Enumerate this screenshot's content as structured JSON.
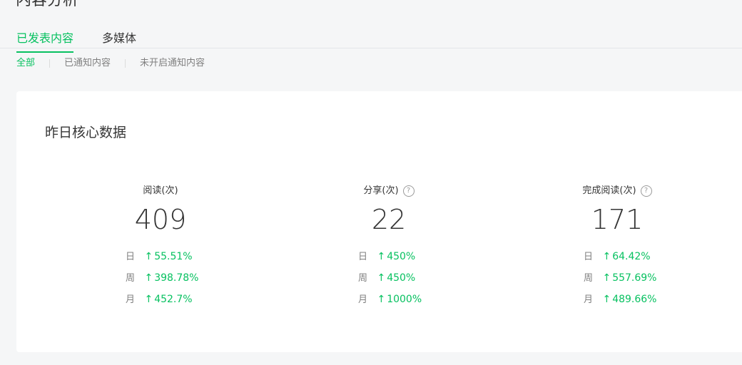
{
  "page": {
    "heading": "内容分析"
  },
  "tabs": [
    {
      "label": "已发表内容",
      "active": true
    },
    {
      "label": "多媒体",
      "active": false
    }
  ],
  "subtabs": [
    {
      "label": "全部",
      "active": true
    },
    {
      "label": "已通知内容",
      "active": false
    },
    {
      "label": "未开启通知内容",
      "active": false
    }
  ],
  "card": {
    "title": "昨日核心数据",
    "metrics": [
      {
        "label": "阅读(次)",
        "help": false,
        "value": "409",
        "changes": [
          {
            "period": "日",
            "arrow": "↑",
            "value": "55.51%"
          },
          {
            "period": "周",
            "arrow": "↑",
            "value": "398.78%"
          },
          {
            "period": "月",
            "arrow": "↑",
            "value": "452.7%"
          }
        ]
      },
      {
        "label": "分享(次)",
        "help": true,
        "value": "22",
        "changes": [
          {
            "period": "日",
            "arrow": "↑",
            "value": "450%"
          },
          {
            "period": "周",
            "arrow": "↑",
            "value": "450%"
          },
          {
            "period": "月",
            "arrow": "↑",
            "value": "1000%"
          }
        ]
      },
      {
        "label": "完成阅读(次)",
        "help": true,
        "value": "171",
        "changes": [
          {
            "period": "日",
            "arrow": "↑",
            "value": "64.42%"
          },
          {
            "period": "周",
            "arrow": "↑",
            "value": "557.69%"
          },
          {
            "period": "月",
            "arrow": "↑",
            "value": "489.66%"
          }
        ]
      }
    ]
  },
  "icons": {
    "help": "question-circle-icon",
    "trend_up": "arrow-up-icon"
  },
  "colors": {
    "accent": "#07c160",
    "text": "#353535",
    "muted": "#7f7f7f",
    "background": "#f5f6f7"
  }
}
